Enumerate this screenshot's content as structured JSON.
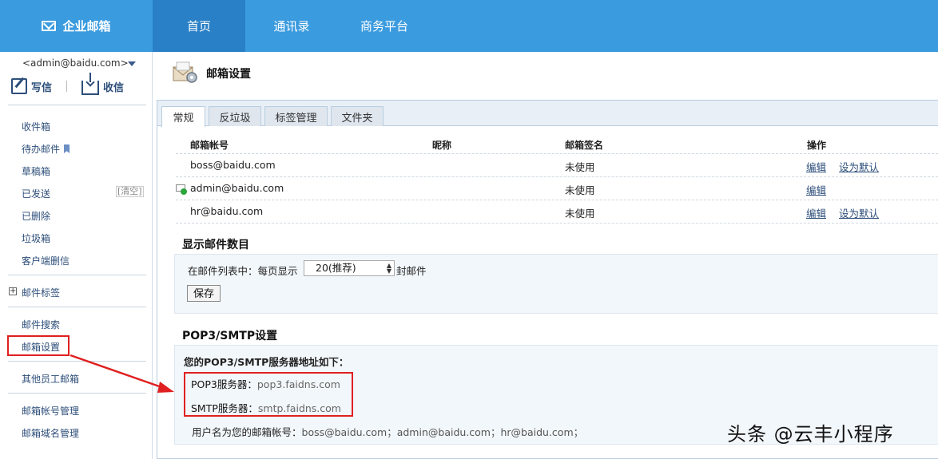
{
  "header": {
    "brand": "企业邮箱",
    "tabs": [
      {
        "label": "首页"
      },
      {
        "label": "通讯录"
      },
      {
        "label": "商务平台"
      }
    ]
  },
  "sidebar": {
    "account": "<admin@baidu.com>",
    "write": "写信",
    "receive": "收信",
    "folders": [
      "收件箱",
      "待办邮件",
      "草稿箱",
      "已发送",
      "已删除",
      "垃圾箱",
      "客户端删信"
    ],
    "clear": "[清空]",
    "tags": "邮件标签",
    "search": "邮件搜索",
    "settings": "邮箱设置",
    "others": "其他员工邮箱",
    "account_mgmt": "邮箱帐号管理",
    "domain_mgmt": "邮箱域名管理"
  },
  "main": {
    "title": "邮箱设置",
    "tabs": [
      "常规",
      "反垃圾",
      "标签管理",
      "文件夹"
    ],
    "table": {
      "headers": {
        "account": "邮箱帐号",
        "nickname": "昵称",
        "signature": "邮箱签名",
        "ops": "操作"
      },
      "rows": [
        {
          "account": "boss@baidu.com",
          "signature": "未使用",
          "edit": "编辑",
          "default": "设为默认"
        },
        {
          "account": "admin@baidu.com",
          "signature": "未使用",
          "edit": "编辑"
        },
        {
          "account": "hr@baidu.com",
          "signature": "未使用",
          "edit": "编辑",
          "default": "设为默认"
        }
      ]
    },
    "display": {
      "title": "显示邮件数目",
      "prefix": "在邮件列表中：每页显示",
      "selected": "20(推荐)",
      "suffix": "封邮件",
      "save": "保存"
    },
    "pop": {
      "title": "POP3/SMTP设置",
      "intro": "您的POP3/SMTP服务器地址如下：",
      "pop_label": "POP3服务器：",
      "pop_value": "pop3.faidns.com",
      "smtp_label": "SMTP服务器：",
      "smtp_value": "smtp.faidns.com",
      "user_label": "用户名为您的邮箱帐号：",
      "user_value": "boss@baidu.com；admin@baidu.com；hr@baidu.com；"
    }
  },
  "watermark": "头条 @云丰小程序",
  "colors": {
    "header": "#3b9bdf",
    "header_active": "#2a80c6",
    "highlight": "#e02020",
    "link": "#2d4e7a"
  }
}
